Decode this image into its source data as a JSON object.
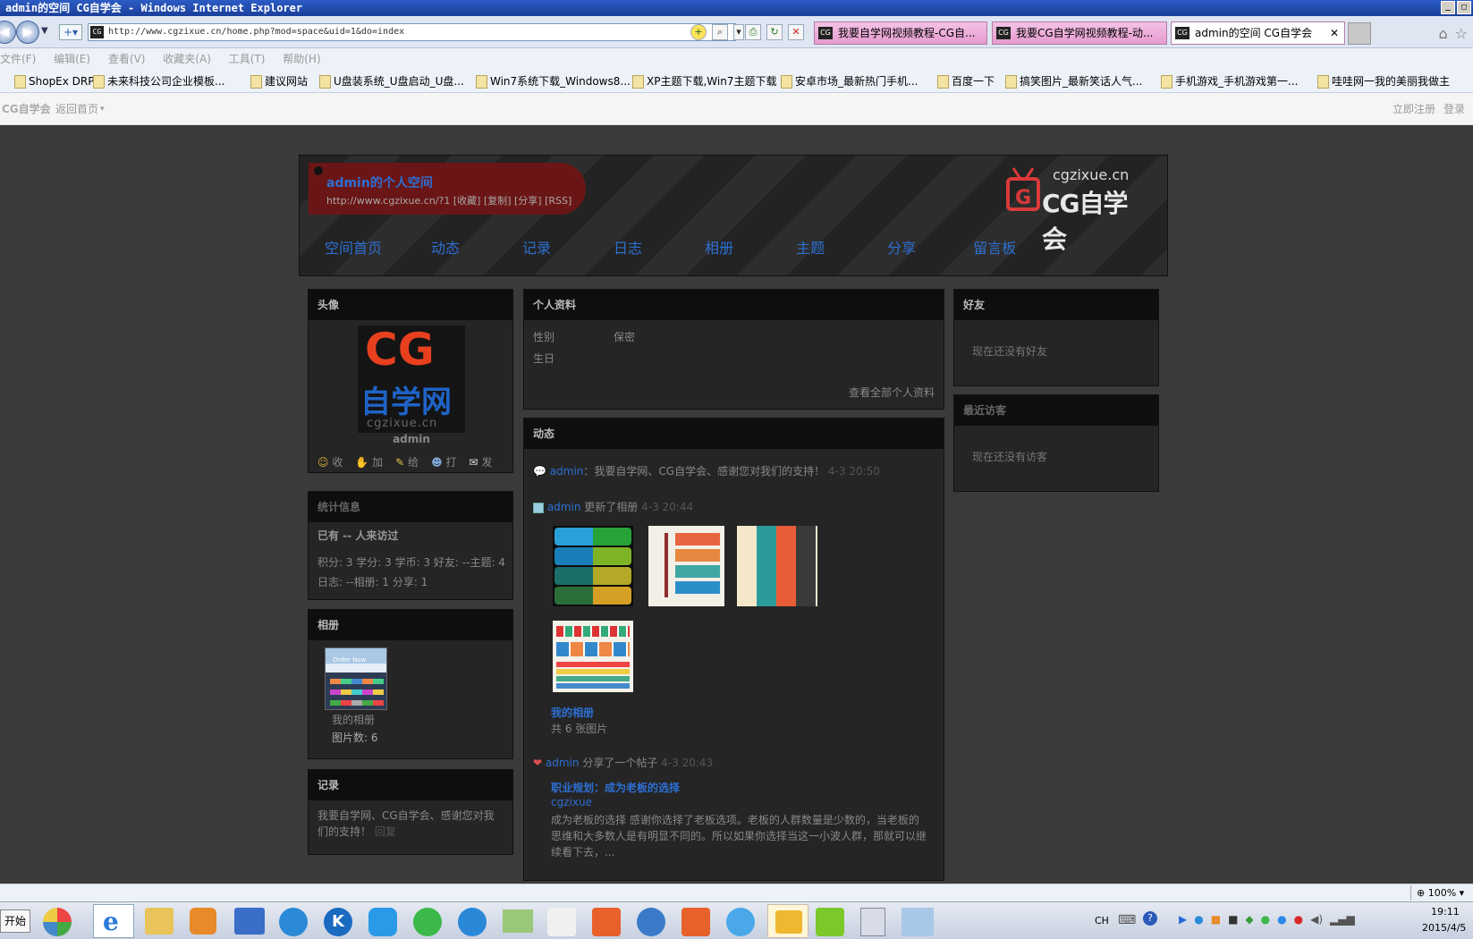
{
  "window": {
    "title": "admin的空间 CG自学会 - Windows Internet Explorer"
  },
  "browser": {
    "address": "http://www.cgzixue.cn/home.php?mod=space&uid=1&do=index",
    "tabs": [
      {
        "label": "我要自学网视频教程-CG自..."
      },
      {
        "label": "我要CG自学网视频教程-动..."
      },
      {
        "label": "admin的空间 CG自学会"
      }
    ],
    "menu": [
      "文件(F)",
      "编辑(E)",
      "查看(V)",
      "收藏夹(A)",
      "工具(T)",
      "帮助(H)"
    ],
    "favorites": [
      "ShopEx DRP",
      "未来科技公司企业模板...",
      "建议网站",
      "U盘装系统_U盘启动_U盘...",
      "Win7系统下载_Windows8...",
      "XP主题下载,Win7主题下载",
      "安卓市场_最新热门手机...",
      "百度一下",
      "搞笑图片_最新笑话人气...",
      "手机游戏_手机游戏第一...",
      "哇哇网一我的美丽我做主"
    ]
  },
  "site": {
    "brand": "CG自学会",
    "back_home": "返回首页",
    "register": "立即注册",
    "login": "登录"
  },
  "header": {
    "space_title": "admin的个人空间",
    "space_url": "http://www.cgzixue.cn/?1 [收藏] [复制] [分享] [RSS]",
    "logo_domain": "cgzixue.cn",
    "logo_text": "CG自学会",
    "nav": [
      "空间首页",
      "动态",
      "记录",
      "日志",
      "相册",
      "主题",
      "分享",
      "留言板"
    ]
  },
  "avatar_panel": {
    "title": "头像",
    "avatar_brand": "CG",
    "avatar_sub": "自学网",
    "avatar_domain": "cgzixue.cn",
    "username": "admin",
    "actions": [
      "收",
      "加",
      "给",
      "打",
      "发"
    ]
  },
  "stats_panel": {
    "title": "统计信息",
    "visitors": "已有 -- 人来访过",
    "line1": "积分: 3 学分: 3 学币: 3 好友: --主题: 4",
    "line2": "日志: --相册: 1 分享: 1"
  },
  "album_panel": {
    "title": "相册",
    "thumb_text": "Order Now",
    "album_name": "我的相册",
    "count": "图片数: 6"
  },
  "record_panel": {
    "title": "记录",
    "text": "我要自学网、CG自学会、感谢您对我们的支持！",
    "reply": "回复"
  },
  "profile_panel": {
    "title": "个人资料",
    "gender_label": "性别",
    "gender_value": "保密",
    "birthday_label": "生日",
    "view_all": "查看全部个人资料"
  },
  "feed_panel": {
    "title": "动态",
    "item1": {
      "user": "admin",
      "text": "：我要自学网、CG自学会、感谢您对我们的支持！",
      "time": "4-3 20:50"
    },
    "item2": {
      "user": "admin",
      "text": "更新了相册",
      "time": "4-3 20:44",
      "album_link": "我的相册",
      "album_count": "共 6 张图片"
    },
    "item3": {
      "user": "admin",
      "text": "分享了一个帖子",
      "time": "4-3 20:43",
      "post_title": "职业规划：成为老板的选择",
      "post_author": "cgzixue",
      "post_excerpt": "成为老板的选择 感谢你选择了老板选项。老板的人群数量是少数的，当老板的思维和大多数人是有明显不同的。所以如果你选择当这一小波人群，那就可以继续看下去，..."
    }
  },
  "friends_panel": {
    "title": "好友",
    "empty": "现在还没有好友"
  },
  "visitors_panel": {
    "title": "最近访客",
    "empty": "现在还没有访客"
  },
  "status": {
    "zoom": "100%"
  },
  "taskbar": {
    "start": "开始",
    "lang": "CH",
    "time": "19:11",
    "date": "2015/4/5"
  },
  "colors": {
    "link": "#2d6fd3",
    "bg": "#3a3a3a",
    "panel": "#252525",
    "panel_header": "#0e0e0e"
  }
}
